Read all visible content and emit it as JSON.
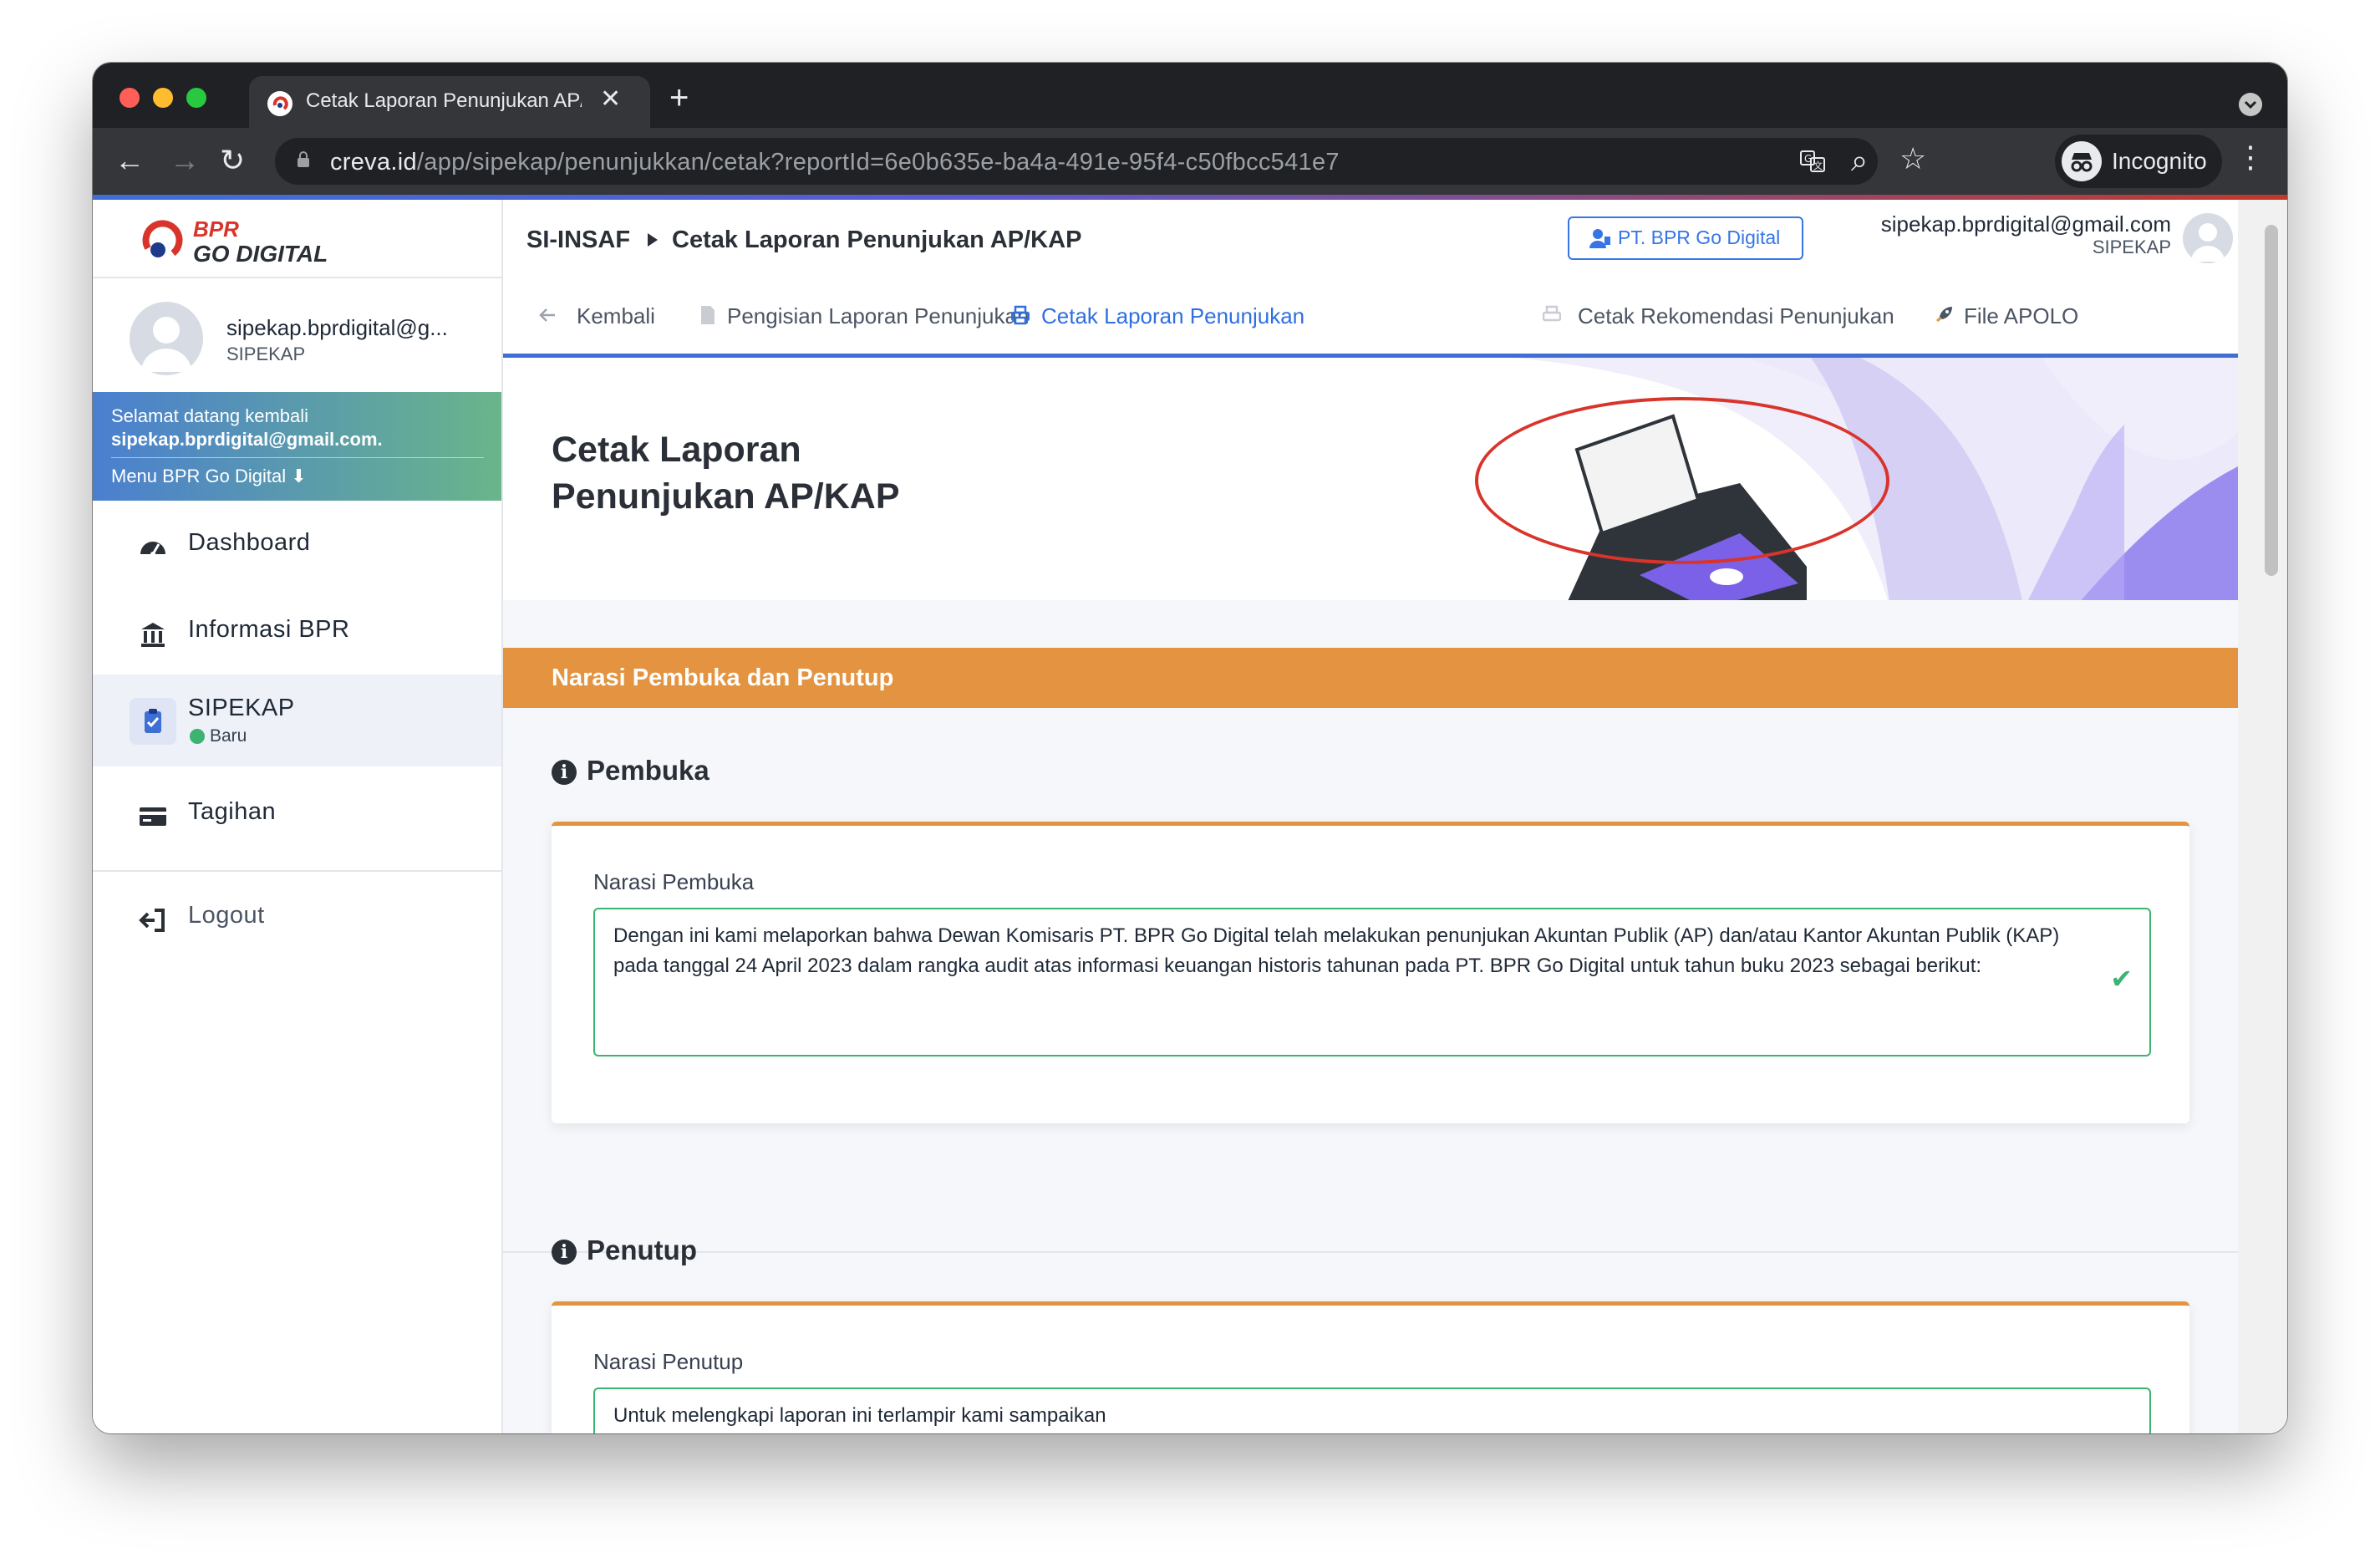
{
  "browser": {
    "tab_title": "Cetak Laporan Penunjukan AP/KAP",
    "tab_close": "✕",
    "new_tab": "+",
    "url_host": "creva.id",
    "url_path": "/app/sipekap/penunjukkan/cetak?reportId=6e0b635e-ba4a-491e-95f4-c50fbcc541e7",
    "incognito_label": "Incognito",
    "nav_back": "←",
    "nav_forward": "→",
    "nav_reload": "↻",
    "zoom_icon": "⌕",
    "star_icon": "☆",
    "menu_icon": "⋮"
  },
  "sidebar": {
    "logo_line1": "BPR",
    "logo_line2": "GO DIGITAL",
    "user_email": "sipekap.bprdigital@g...",
    "user_role": "SIPEKAP",
    "welcome_line1": "Selamat datang kembali",
    "welcome_line2": "sipekap.bprdigital@gmail.com.",
    "welcome_menu": "Menu BPR Go Digital ⬇",
    "items": [
      {
        "label": "Dashboard",
        "icon": "dashboard-gauge-icon"
      },
      {
        "label": "Informasi BPR",
        "icon": "bank-icon"
      },
      {
        "label": "SIPEKAP",
        "sub": "Baru",
        "icon": "clipboard-check-icon"
      },
      {
        "label": "Tagihan",
        "icon": "credit-card-icon"
      }
    ],
    "logout": "Logout"
  },
  "topbar": {
    "crumb_root": "SI-INSAF",
    "crumb_current": "Cetak Laporan Penunjukan AP/KAP",
    "bpr_button": "PT. BPR Go Digital",
    "user_email": "sipekap.bprdigital@gmail.com",
    "user_role": "SIPEKAP"
  },
  "nav_tabs": {
    "back": "Kembali",
    "pengisian": "Pengisian Laporan Penunjukan",
    "cetak": "Cetak Laporan Penunjukan",
    "rekomendasi": "Cetak Rekomendasi Penunjukan",
    "apolo": "File APOLO"
  },
  "hero": {
    "title_line1": "Cetak Laporan",
    "title_line2": "Penunjukan AP/KAP"
  },
  "section": {
    "title": "Narasi Pembuka dan Penutup",
    "pembuka_heading": "Pembuka",
    "pembuka_label": "Narasi Pembuka",
    "pembuka_text": "Dengan ini kami melaporkan bahwa Dewan Komisaris PT. BPR Go Digital telah melakukan penunjukan Akuntan Publik (AP) dan/atau Kantor Akuntan Publik (KAP) pada tanggal 24 April  2023 dalam rangka audit atas informasi keuangan historis tahunan pada PT. BPR Go Digital untuk tahun buku 2023 sebagai berikut:",
    "check_mark": "✔",
    "penutup_heading": "Penutup",
    "penutup_label": "Narasi Penutup",
    "penutup_text": "Untuk melengkapi laporan ini terlampir kami sampaikan"
  },
  "colors": {
    "accent_blue": "#3d6fd6",
    "section_orange": "#e49440",
    "valid_green": "#3cb371",
    "annotation_red": "#d9342b"
  }
}
